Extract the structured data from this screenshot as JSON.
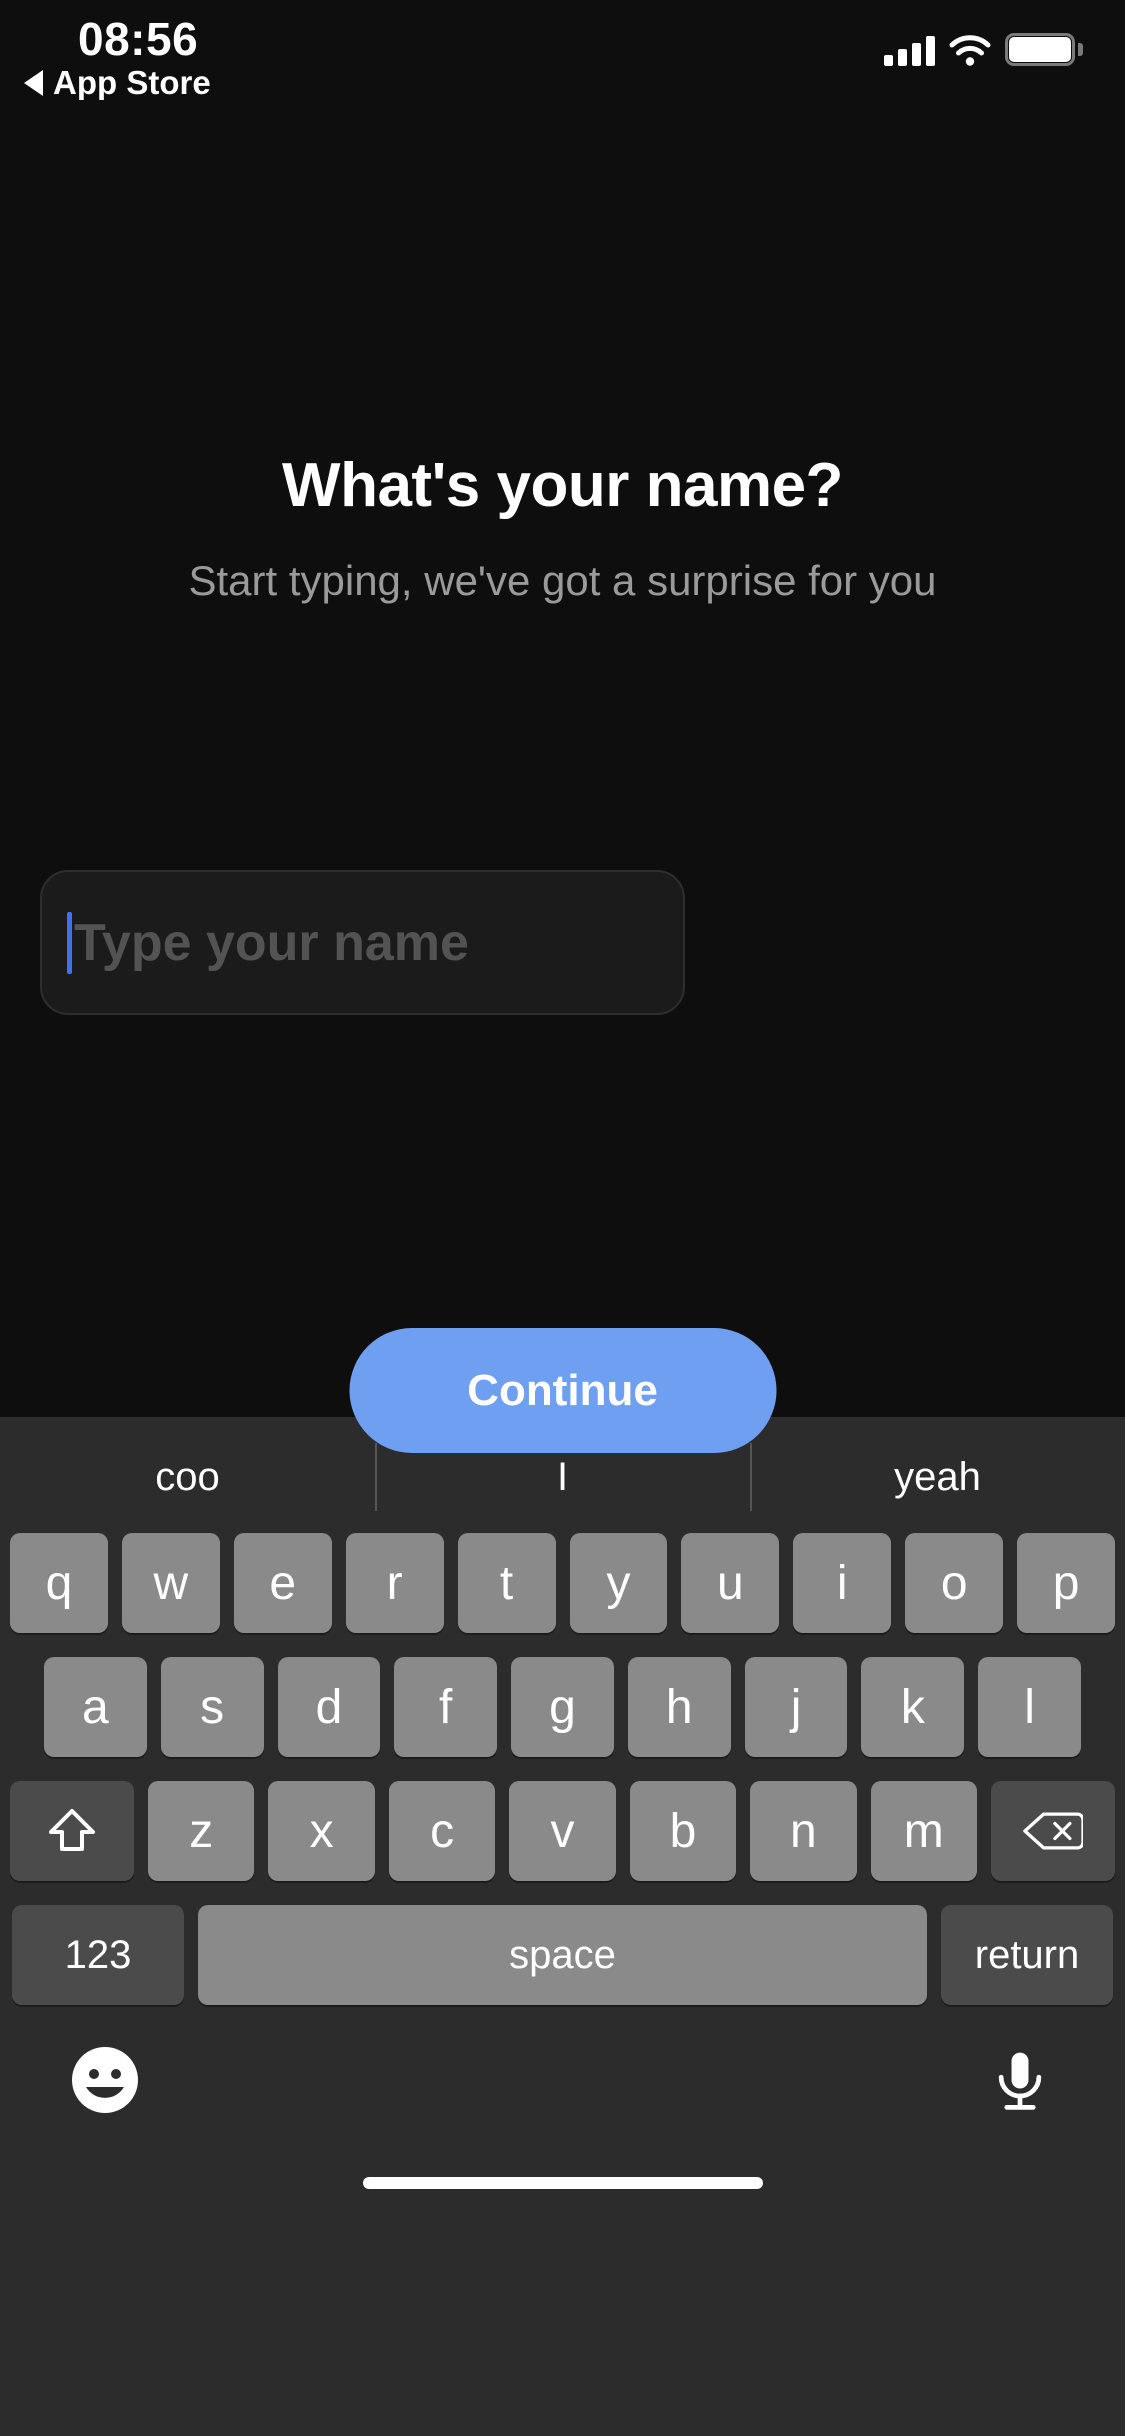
{
  "status_bar": {
    "time": "08:56",
    "back_label": "App Store",
    "back_arrow_icon": "triangle-left-icon",
    "signal_icon": "cellular-signal-icon",
    "signal_bars": 4,
    "wifi_icon": "wifi-icon",
    "battery_icon": "battery-full-icon",
    "battery_level_percent": 100
  },
  "screen": {
    "background_color": "#0e0e0e",
    "title": "What's your name?",
    "subtitle": "Start typing, we've got a surprise for you"
  },
  "name_input": {
    "value": "",
    "placeholder": "Type your name",
    "caret_color": "#3f71f0",
    "border_color": "#2e2e2e",
    "background_color": "#1b1b1b"
  },
  "continue_button": {
    "label": "Continue",
    "background_color": "#6f9ff0",
    "text_color": "#ffffff"
  },
  "keyboard": {
    "background_color": "#2c2c2c",
    "key_color": "#8a8a8a",
    "dark_key_color": "#4b4b4b",
    "suggestions": [
      "coo",
      "I",
      "yeah"
    ],
    "row1": [
      "q",
      "w",
      "e",
      "r",
      "t",
      "y",
      "u",
      "i",
      "o",
      "p"
    ],
    "row2": [
      "a",
      "s",
      "d",
      "f",
      "g",
      "h",
      "j",
      "k",
      "l"
    ],
    "row3": [
      "z",
      "x",
      "c",
      "v",
      "b",
      "n",
      "m"
    ],
    "shift_icon": "shift-arrow-up-icon",
    "delete_icon": "backspace-delete-icon",
    "numeric_label": "123",
    "space_label": "space",
    "return_label": "return",
    "emoji_icon": "smiley-face-icon",
    "dictation_icon": "microphone-icon"
  },
  "home_indicator": {
    "name": "home-indicator"
  }
}
